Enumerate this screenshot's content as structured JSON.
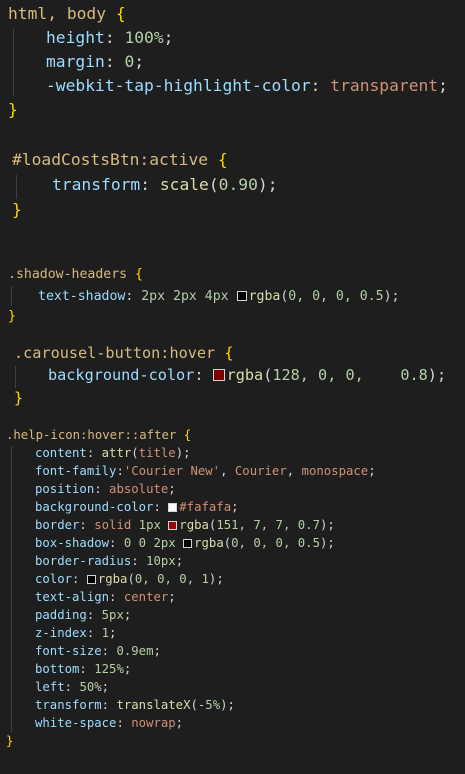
{
  "colors": {
    "background": "#1e1e1e",
    "selector": "#d7ba7d",
    "property": "#9cdcfe",
    "number": "#b5cea8",
    "string": "#ce9178",
    "function": "#dcdcaa",
    "brace": "#ffd700",
    "swatch_black": "#000000",
    "swatch_crimson": "#800000",
    "swatch_white": "#fafafa",
    "swatch_red": "#970707"
  },
  "block1": {
    "selector": "html, body",
    "open": "{",
    "close": "}",
    "height_prop": "height",
    "height_val": "100%",
    "margin_prop": "margin",
    "margin_val": "0",
    "tap_prop": "-webkit-tap-highlight-color",
    "tap_val": "transparent"
  },
  "block2": {
    "selector": "#loadCostsBtn:active",
    "open": "{",
    "close": "}",
    "transform_prop": "transform",
    "fn": "scale",
    "arg": "0.90"
  },
  "block3": {
    "selector": ".shadow-headers",
    "open": "{",
    "close": "}",
    "prop": "text-shadow",
    "v1": "2px",
    "v2": "2px",
    "v3": "4px",
    "fn": "rgba",
    "args": "0, 0, 0, 0.5"
  },
  "block4": {
    "selector": ".carousel-button:hover",
    "open": "{",
    "close": "}",
    "prop": "background-color",
    "fn": "rgba",
    "args_a": "128, 0, 0,",
    "args_b": "0.8"
  },
  "block5": {
    "selector": ".help-icon:hover::after",
    "open": "{",
    "close": "}",
    "content_prop": "content",
    "content_fn": "attr",
    "content_arg": "title",
    "ff_prop": "font-family",
    "ff_val1": "'Courier New'",
    "ff_val2": "Courier",
    "ff_val3": "monospace",
    "pos_prop": "position",
    "pos_val": "absolute",
    "bg_prop": "background-color",
    "bg_val": "#fafafa",
    "border_prop": "border",
    "border_v1": "solid",
    "border_v2": "1px",
    "border_fn": "rgba",
    "border_args": "151, 7, 7, 0.7",
    "bs_prop": "box-shadow",
    "bs_v1": "0",
    "bs_v2": "0",
    "bs_v3": "2px",
    "bs_fn": "rgba",
    "bs_args": "0, 0, 0, 0.5",
    "br_prop": "border-radius",
    "br_val": "10px",
    "color_prop": "color",
    "color_fn": "rgba",
    "color_args": "0, 0, 0, 1",
    "ta_prop": "text-align",
    "ta_val": "center",
    "pad_prop": "padding",
    "pad_val": "5px",
    "z_prop": "z-index",
    "z_val": "1",
    "fs_prop": "font-size",
    "fs_val": "0.9em",
    "bottom_prop": "bottom",
    "bottom_val": "125%",
    "left_prop": "left",
    "left_val": "50%",
    "tr_prop": "transform",
    "tr_fn": "translateX",
    "tr_arg": "-5%",
    "ws_prop": "white-space",
    "ws_val": "nowrap"
  }
}
